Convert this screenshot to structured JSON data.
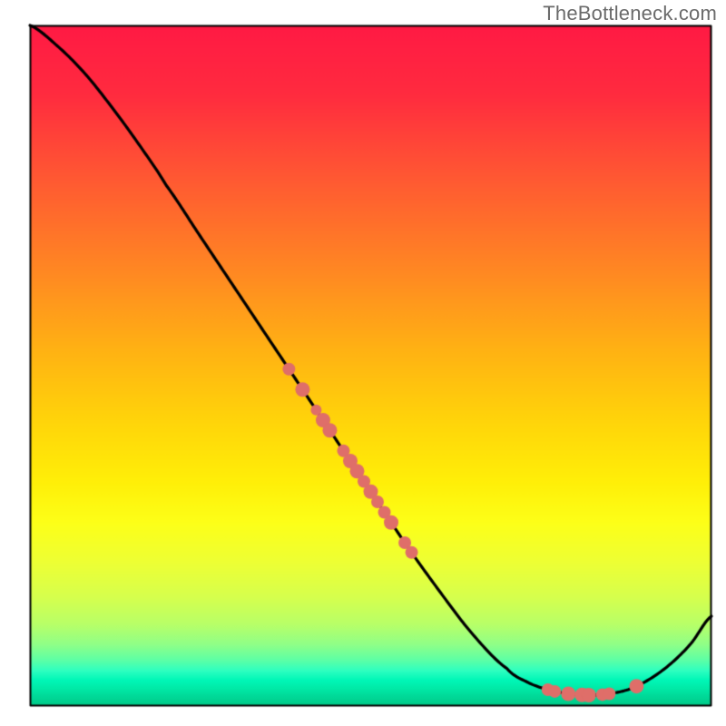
{
  "attribution": "TheBottleneck.com",
  "plot": {
    "margin_left": 33,
    "margin_right": 16,
    "margin_top": 28,
    "margin_bottom": 22,
    "x_range": [
      0,
      100
    ],
    "y_range": [
      0,
      100
    ]
  },
  "gradient_stops": [
    {
      "pos": 0.0,
      "color": "#ff1a44"
    },
    {
      "pos": 0.1,
      "color": "#ff2b3f"
    },
    {
      "pos": 0.22,
      "color": "#ff5733"
    },
    {
      "pos": 0.35,
      "color": "#ff8424"
    },
    {
      "pos": 0.48,
      "color": "#ffb313"
    },
    {
      "pos": 0.58,
      "color": "#ffd40a"
    },
    {
      "pos": 0.67,
      "color": "#ffef08"
    },
    {
      "pos": 0.73,
      "color": "#fdff18"
    },
    {
      "pos": 0.79,
      "color": "#edff35"
    },
    {
      "pos": 0.84,
      "color": "#d6ff4d"
    },
    {
      "pos": 0.88,
      "color": "#b8ff68"
    },
    {
      "pos": 0.91,
      "color": "#8fff88"
    },
    {
      "pos": 0.932,
      "color": "#5effa5"
    },
    {
      "pos": 0.948,
      "color": "#2effc0"
    },
    {
      "pos": 0.962,
      "color": "#00f7b7"
    },
    {
      "pos": 0.975,
      "color": "#00e9a6"
    },
    {
      "pos": 0.986,
      "color": "#00d998"
    },
    {
      "pos": 1.0,
      "color": "#00c987"
    }
  ],
  "chart_data": {
    "type": "line",
    "title": "",
    "xlabel": "",
    "ylabel": "",
    "xlim": [
      0,
      100
    ],
    "ylim": [
      0,
      100
    ],
    "series": [
      {
        "name": "curve",
        "x": [
          0,
          4,
          8,
          12,
          16,
          20,
          25,
          30,
          35,
          40,
          45,
          50,
          55,
          60,
          65,
          70,
          73,
          76,
          79,
          82,
          85,
          88,
          91,
          94,
          97,
          100
        ],
        "y": [
          100,
          97,
          93,
          88,
          82.5,
          76.5,
          69,
          61.5,
          54,
          46.5,
          39,
          31.5,
          24,
          17,
          10.5,
          5.5,
          3.5,
          2.4,
          1.8,
          1.6,
          1.8,
          2.5,
          4.0,
          6.2,
          9.2,
          13.2
        ]
      }
    ],
    "scatter_on_curve": {
      "x": [
        38,
        40,
        42,
        43,
        44,
        46,
        47,
        48,
        49,
        50,
        51,
        52,
        53,
        55,
        56,
        76,
        77,
        79,
        81,
        82,
        84,
        85,
        89
      ],
      "r": [
        7,
        8,
        6,
        8,
        8,
        7,
        8,
        8,
        7,
        8,
        7,
        7,
        8,
        7,
        7,
        7,
        7,
        8,
        8,
        8,
        7,
        7,
        8
      ]
    },
    "marker_color": "#df6e69"
  }
}
